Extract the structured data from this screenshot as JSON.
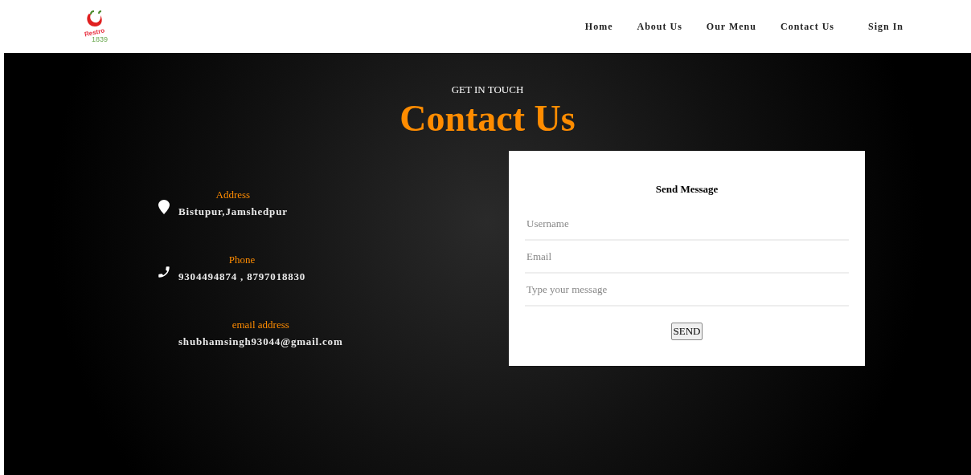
{
  "logo": {
    "name": "Restro",
    "year": "1839"
  },
  "nav": [
    {
      "label": "Home"
    },
    {
      "label": "About Us"
    },
    {
      "label": "Our Menu"
    },
    {
      "label": "Contact Us"
    },
    {
      "label": "Sign In"
    }
  ],
  "hero": {
    "eyebrow": "GET IN TOUCH",
    "title": "Contact Us"
  },
  "contact_items": [
    {
      "kind": "address",
      "label": "Address",
      "value": "Bistupur,Jamshedpur"
    },
    {
      "kind": "phone",
      "label": "Phone",
      "value": "9304494874 , 8797018830"
    },
    {
      "kind": "email",
      "label": "email address",
      "value": "shubhamsingh93044@gmail.com"
    }
  ],
  "form": {
    "title": "Send Message",
    "fields": [
      {
        "placeholder": "Username"
      },
      {
        "placeholder": "Email"
      },
      {
        "placeholder": "Type your message"
      }
    ],
    "button": "SEND"
  }
}
